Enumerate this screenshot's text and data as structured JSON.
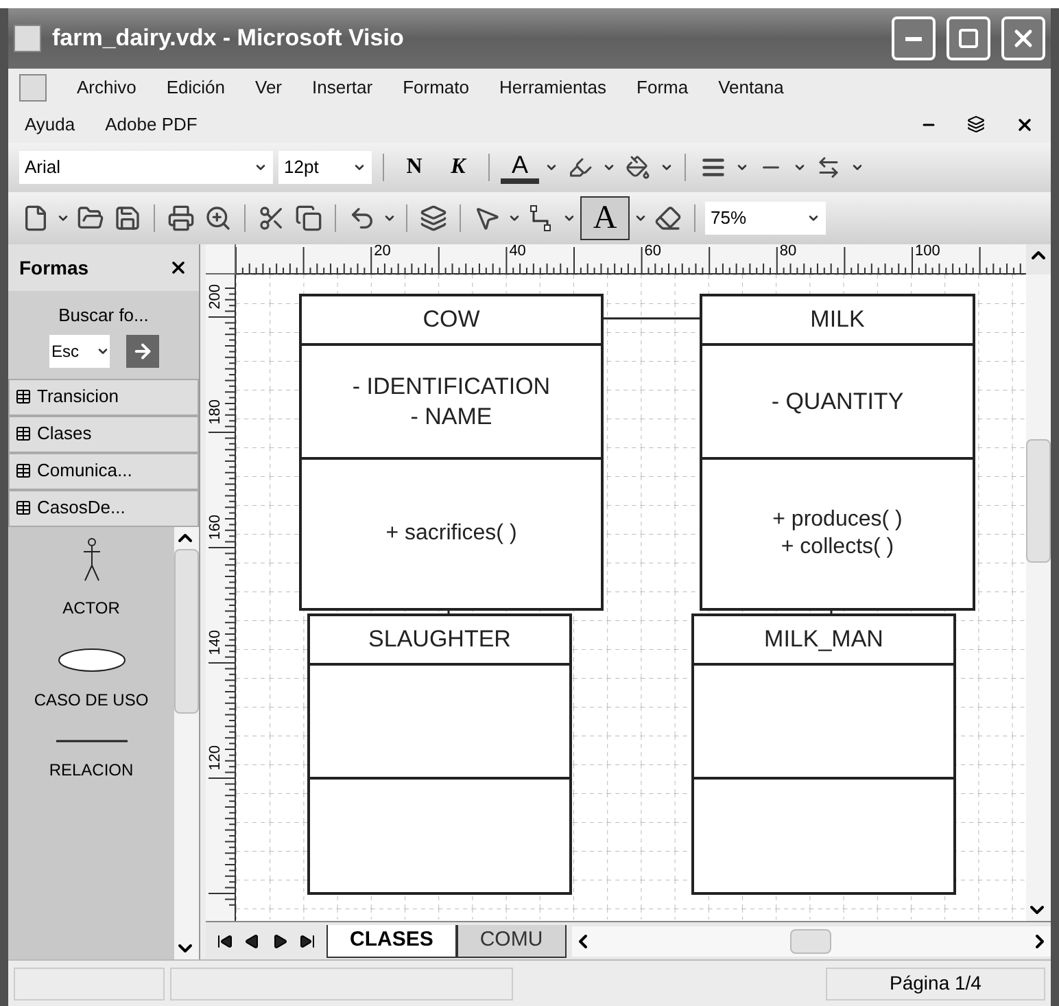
{
  "window": {
    "title": "farm_dairy.vdx - Microsoft Visio"
  },
  "menu": [
    "Archivo",
    "Edición",
    "Ver",
    "Insertar",
    "Formato",
    "Herramientas",
    "Forma",
    "Ventana",
    "Ayuda",
    "Adobe PDF"
  ],
  "format_toolbar": {
    "font": "Arial",
    "size": "12pt",
    "bold": "N",
    "italic": "K",
    "font_color": "A"
  },
  "standard_toolbar": {
    "text_tool": {
      "label": "A",
      "selected": true
    },
    "zoom": "75%"
  },
  "shapes_panel": {
    "title": "Formas",
    "search_label": "Buscar fo...",
    "search_value": "Esc",
    "stencils": [
      "Transicion",
      "Clases",
      "Comunica...",
      "CasosDe..."
    ],
    "shapes": [
      {
        "kind": "actor",
        "label": "ACTOR"
      },
      {
        "kind": "usecase",
        "label": "CASO DE USO"
      },
      {
        "kind": "relation",
        "label": "RELACION"
      }
    ]
  },
  "rulers": {
    "horizontal": [
      "20",
      "40",
      "60",
      "80",
      "100"
    ],
    "vertical": [
      "200",
      "180",
      "160",
      "140",
      "120"
    ]
  },
  "diagram": {
    "classes": [
      {
        "name": "COW",
        "attributes": [
          "- IDENTIFICATION",
          "- NAME"
        ],
        "methods": [
          "+ sacrifices( )"
        ]
      },
      {
        "name": "MILK",
        "attributes": [
          "- QUANTITY"
        ],
        "methods": [
          "+ produces( )",
          "+ collects( )"
        ]
      },
      {
        "name": "SLAUGHTER"
      },
      {
        "name": "MILK_MAN"
      }
    ]
  },
  "page_tabs": [
    {
      "label": "CLASES",
      "selected": true
    },
    {
      "label": "COMU",
      "selected": false
    }
  ],
  "status_bar": {
    "page": "Página 1/4"
  }
}
